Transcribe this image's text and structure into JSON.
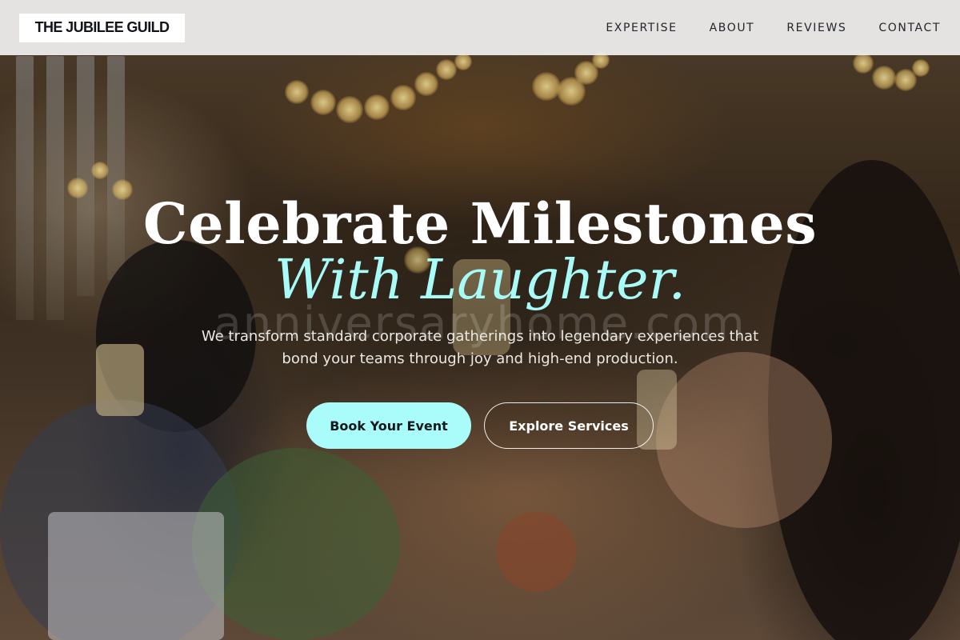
{
  "header": {
    "logo_text": "THE JUBILEE GUILD",
    "nav": [
      {
        "label": "EXPERTISE"
      },
      {
        "label": "ABOUT"
      },
      {
        "label": "REVIEWS"
      },
      {
        "label": "CONTACT"
      }
    ]
  },
  "hero": {
    "headline_line1": "Celebrate Milestones",
    "headline_line2": "With Laughter.",
    "watermark": "anniversaryhome.com",
    "subtitle": "We transform standard corporate gatherings into legendary experiences that bond your teams through joy and high-end production.",
    "primary_cta": "Book Your Event",
    "secondary_cta": "Explore Services"
  },
  "colors": {
    "accent": "#a9fcf9",
    "header_bg": "#f0f0f0",
    "text_dark": "#111418"
  }
}
